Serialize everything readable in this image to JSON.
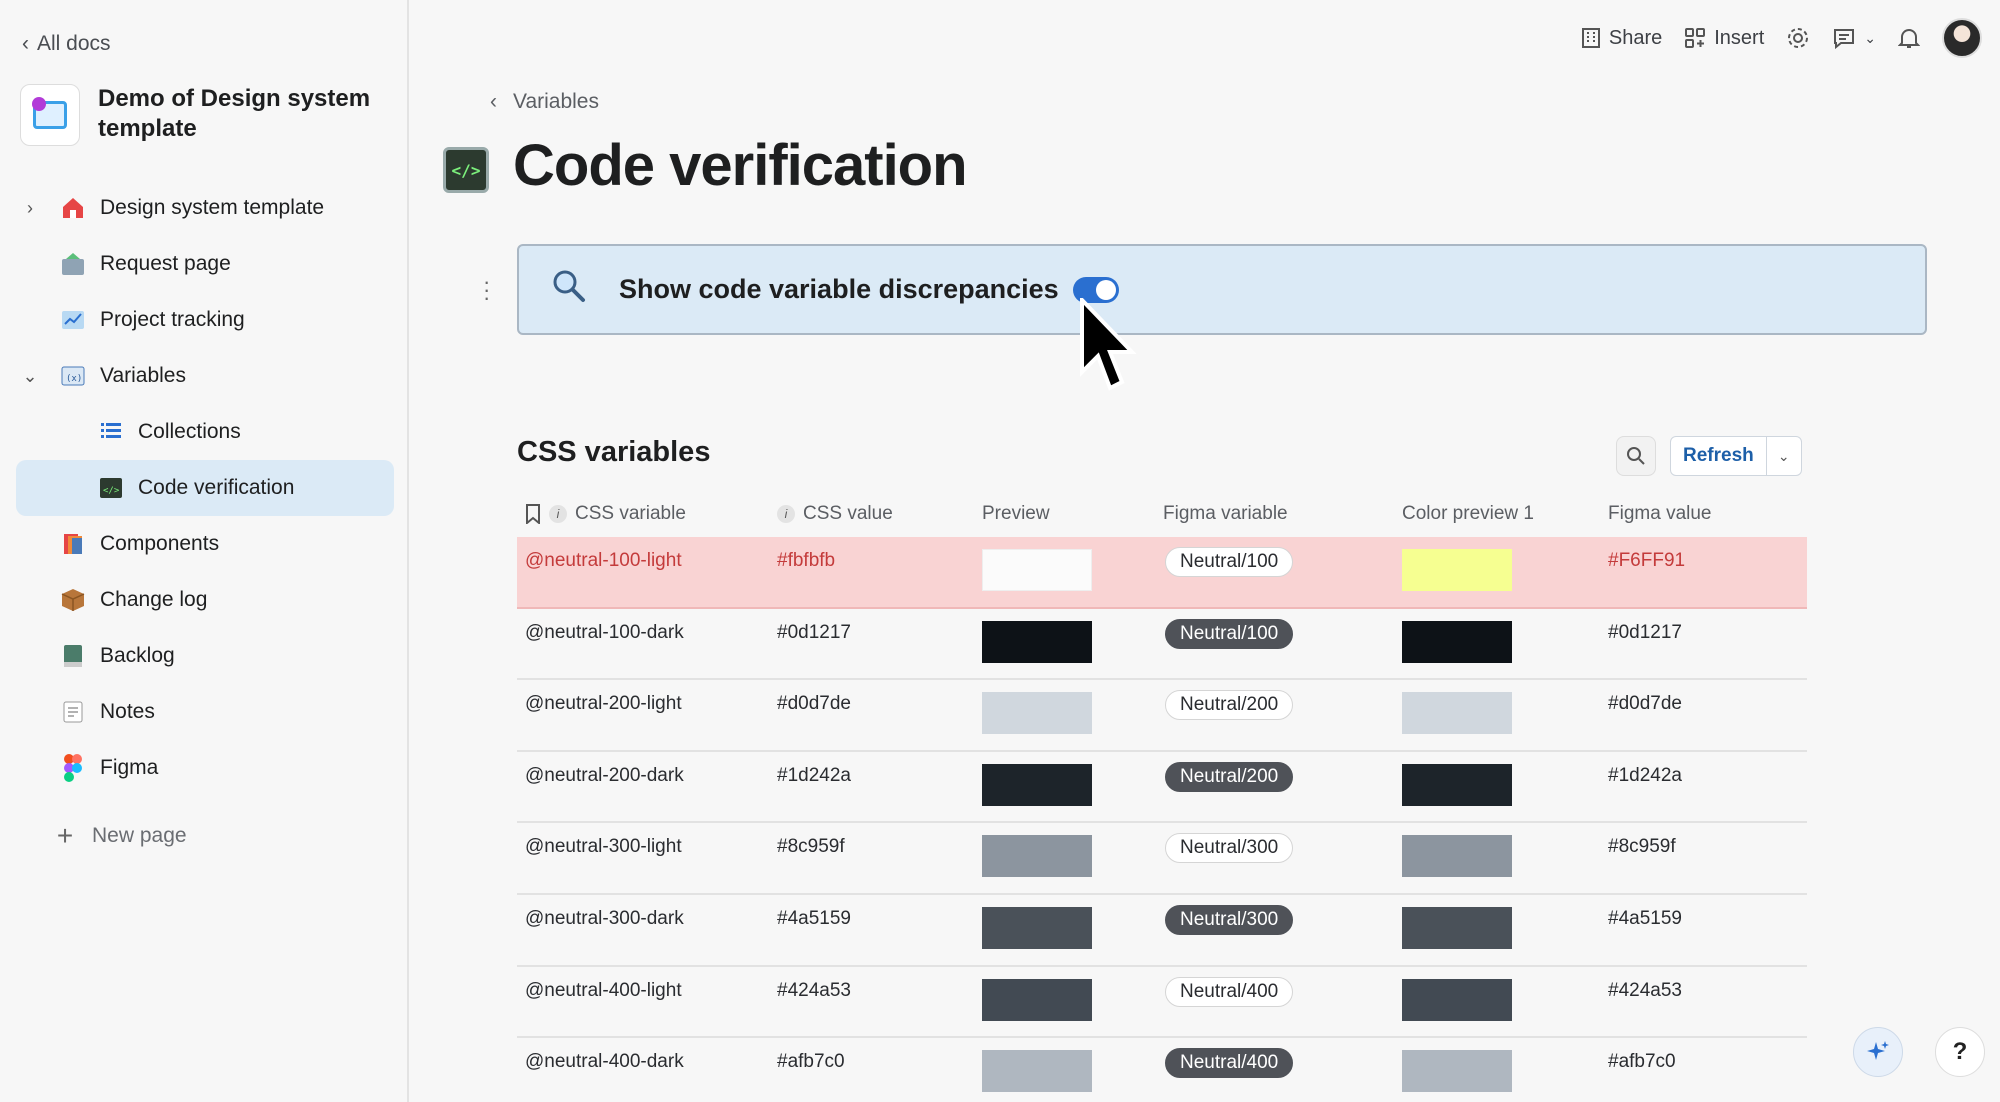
{
  "sidebar": {
    "back_label": "All docs",
    "doc_title": "Demo of Design system template",
    "items": [
      {
        "label": "Design system template",
        "icon": "house-icon"
      },
      {
        "label": "Request page",
        "icon": "request-icon"
      },
      {
        "label": "Project tracking",
        "icon": "chart-icon"
      },
      {
        "label": "Variables",
        "icon": "variables-icon"
      },
      {
        "label": "Collections",
        "icon": "list-icon"
      },
      {
        "label": "Code verification",
        "icon": "code-icon"
      },
      {
        "label": "Components",
        "icon": "components-icon"
      },
      {
        "label": "Change log",
        "icon": "box-icon"
      },
      {
        "label": "Backlog",
        "icon": "book-icon"
      },
      {
        "label": "Notes",
        "icon": "note-icon"
      },
      {
        "label": "Figma",
        "icon": "figma-icon"
      }
    ],
    "new_page_label": "New page"
  },
  "topbar": {
    "share_label": "Share",
    "insert_label": "Insert"
  },
  "main": {
    "breadcrumb": "Variables",
    "title": "Code verification",
    "callout_text": "Show code variable discrepancies",
    "toggle_on": true,
    "section_title": "CSS variables",
    "refresh_label": "Refresh",
    "columns": [
      "CSS variable",
      "CSS value",
      "Preview",
      "Figma variable",
      "Color preview 1",
      "Figma value"
    ],
    "rows": [
      {
        "css_var": "@neutral-100-light",
        "css_value": "#fbfbfb",
        "preview": "#fbfbfb",
        "figma_var": "Neutral/100",
        "pill": "light",
        "color_preview": "#F6FF91",
        "figma_value": "#F6FF91",
        "mismatch": true
      },
      {
        "css_var": "@neutral-100-dark",
        "css_value": "#0d1217",
        "preview": "#0d1217",
        "figma_var": "Neutral/100",
        "pill": "dark",
        "color_preview": "#0d1217",
        "figma_value": "#0d1217",
        "mismatch": false
      },
      {
        "css_var": "@neutral-200-light",
        "css_value": "#d0d7de",
        "preview": "#d0d7de",
        "figma_var": "Neutral/200",
        "pill": "light",
        "color_preview": "#d0d7de",
        "figma_value": "#d0d7de",
        "mismatch": false
      },
      {
        "css_var": "@neutral-200-dark",
        "css_value": "#1d242a",
        "preview": "#1d242a",
        "figma_var": "Neutral/200",
        "pill": "dark",
        "color_preview": "#1d242a",
        "figma_value": "#1d242a",
        "mismatch": false
      },
      {
        "css_var": "@neutral-300-light",
        "css_value": "#8c959f",
        "preview": "#8c959f",
        "figma_var": "Neutral/300",
        "pill": "light",
        "color_preview": "#8c959f",
        "figma_value": "#8c959f",
        "mismatch": false
      },
      {
        "css_var": "@neutral-300-dark",
        "css_value": "#4a5159",
        "preview": "#4a5159",
        "figma_var": "Neutral/300",
        "pill": "dark",
        "color_preview": "#4a5159",
        "figma_value": "#4a5159",
        "mismatch": false
      },
      {
        "css_var": "@neutral-400-light",
        "css_value": "#424a53",
        "preview": "#424a53",
        "figma_var": "Neutral/400",
        "pill": "light",
        "color_preview": "#424a53",
        "figma_value": "#424a53",
        "mismatch": false
      },
      {
        "css_var": "@neutral-400-dark",
        "css_value": "#afb7c0",
        "preview": "#afb7c0",
        "figma_var": "Neutral/400",
        "pill": "dark",
        "color_preview": "#afb7c0",
        "figma_value": "#afb7c0",
        "mismatch": false
      }
    ]
  },
  "colors": {
    "accent": "#2a6fd0",
    "callout_bg": "#dbeaf6",
    "mismatch_bg": "#f9d3d3",
    "mismatch_text": "#c43b3b"
  }
}
